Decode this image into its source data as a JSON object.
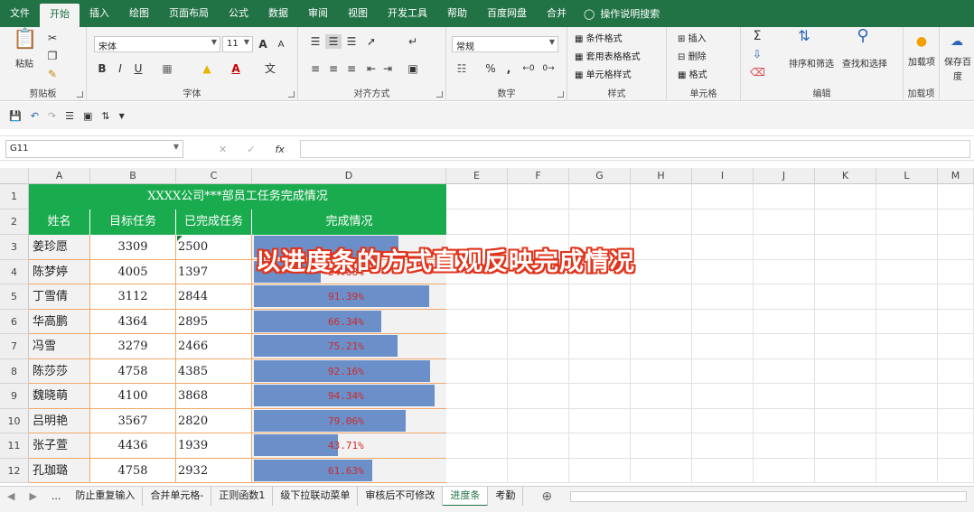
{
  "menu": {
    "tabs": [
      "文件",
      "开始",
      "插入",
      "绘图",
      "页面布局",
      "公式",
      "数据",
      "审阅",
      "视图",
      "开发工具",
      "帮助",
      "百度网盘",
      "合并"
    ],
    "active": "开始",
    "tell_me": "操作说明搜索"
  },
  "ribbon": {
    "clipboard": {
      "label": "剪贴板",
      "paste": "粘贴"
    },
    "font": {
      "label": "字体",
      "name": "宋体",
      "size": "11",
      "bold": "B",
      "italic": "I",
      "underline": "U",
      "grow": "A",
      "shrink": "A",
      "wen": "文"
    },
    "align": {
      "label": "对齐方式"
    },
    "number": {
      "label": "数字",
      "format": "常规",
      "percent": "%",
      "comma": ","
    },
    "styles": {
      "label": "样式",
      "cond": "条件格式",
      "table": "套用表格格式",
      "cell": "单元格样式"
    },
    "cells": {
      "label": "单元格",
      "insert": "插入",
      "delete": "删除",
      "format": "格式"
    },
    "edit": {
      "label": "编辑",
      "sort": "排序和筛选",
      "find": "查找和选择",
      "sigma": "Σ"
    },
    "addin": {
      "label": "加载项",
      "text": "加载项"
    },
    "extra": {
      "text": "保存百度"
    }
  },
  "formula": {
    "namebox": "G11",
    "fx": "fx",
    "cancel": "✕",
    "confirm": "✓"
  },
  "columns": [
    "A",
    "B",
    "C",
    "D",
    "E",
    "F",
    "G",
    "H",
    "I",
    "J",
    "K",
    "L",
    "M"
  ],
  "rows": [
    "1",
    "2",
    "3",
    "4",
    "5",
    "6",
    "7",
    "8",
    "9",
    "10",
    "11",
    "12"
  ],
  "sheet": {
    "title": "XXXX公司***部员工任务完成情况",
    "headers": [
      "姓名",
      "目标任务",
      "已完成任务",
      "完成情况"
    ],
    "data": [
      {
        "name": "姜珍愿",
        "target": "3309",
        "done": "2500",
        "pct": "",
        "frac": 0.755
      },
      {
        "name": "陈梦婷",
        "target": "4005",
        "done": "1397",
        "pct": "34.88%",
        "frac": 0.3488
      },
      {
        "name": "丁雪倩",
        "target": "3112",
        "done": "2844",
        "pct": "91.39%",
        "frac": 0.9139
      },
      {
        "name": "华高鹏",
        "target": "4364",
        "done": "2895",
        "pct": "66.34%",
        "frac": 0.6634
      },
      {
        "name": "冯雪",
        "target": "3279",
        "done": "2466",
        "pct": "75.21%",
        "frac": 0.7521
      },
      {
        "name": "陈莎莎",
        "target": "4758",
        "done": "4385",
        "pct": "92.16%",
        "frac": 0.9216
      },
      {
        "name": "魏晓萌",
        "target": "4100",
        "done": "3868",
        "pct": "94.34%",
        "frac": 0.9434
      },
      {
        "name": "吕明艳",
        "target": "3567",
        "done": "2820",
        "pct": "79.06%",
        "frac": 0.7906
      },
      {
        "name": "张子萱",
        "target": "4436",
        "done": "1939",
        "pct": "43.71%",
        "frac": 0.4371
      },
      {
        "name": "孔珈璐",
        "target": "4758",
        "done": "2932",
        "pct": "61.63%",
        "frac": 0.6163
      }
    ],
    "overlay": "以进度条的方式直观反映完成情况"
  },
  "sheets": {
    "tabs": [
      "防止重复输入",
      "合并单元格-",
      "正则函数1",
      "级下拉联动菜单",
      "审核后不可修改",
      "进度条",
      "考勤"
    ],
    "active": "进度条",
    "more": "..."
  }
}
